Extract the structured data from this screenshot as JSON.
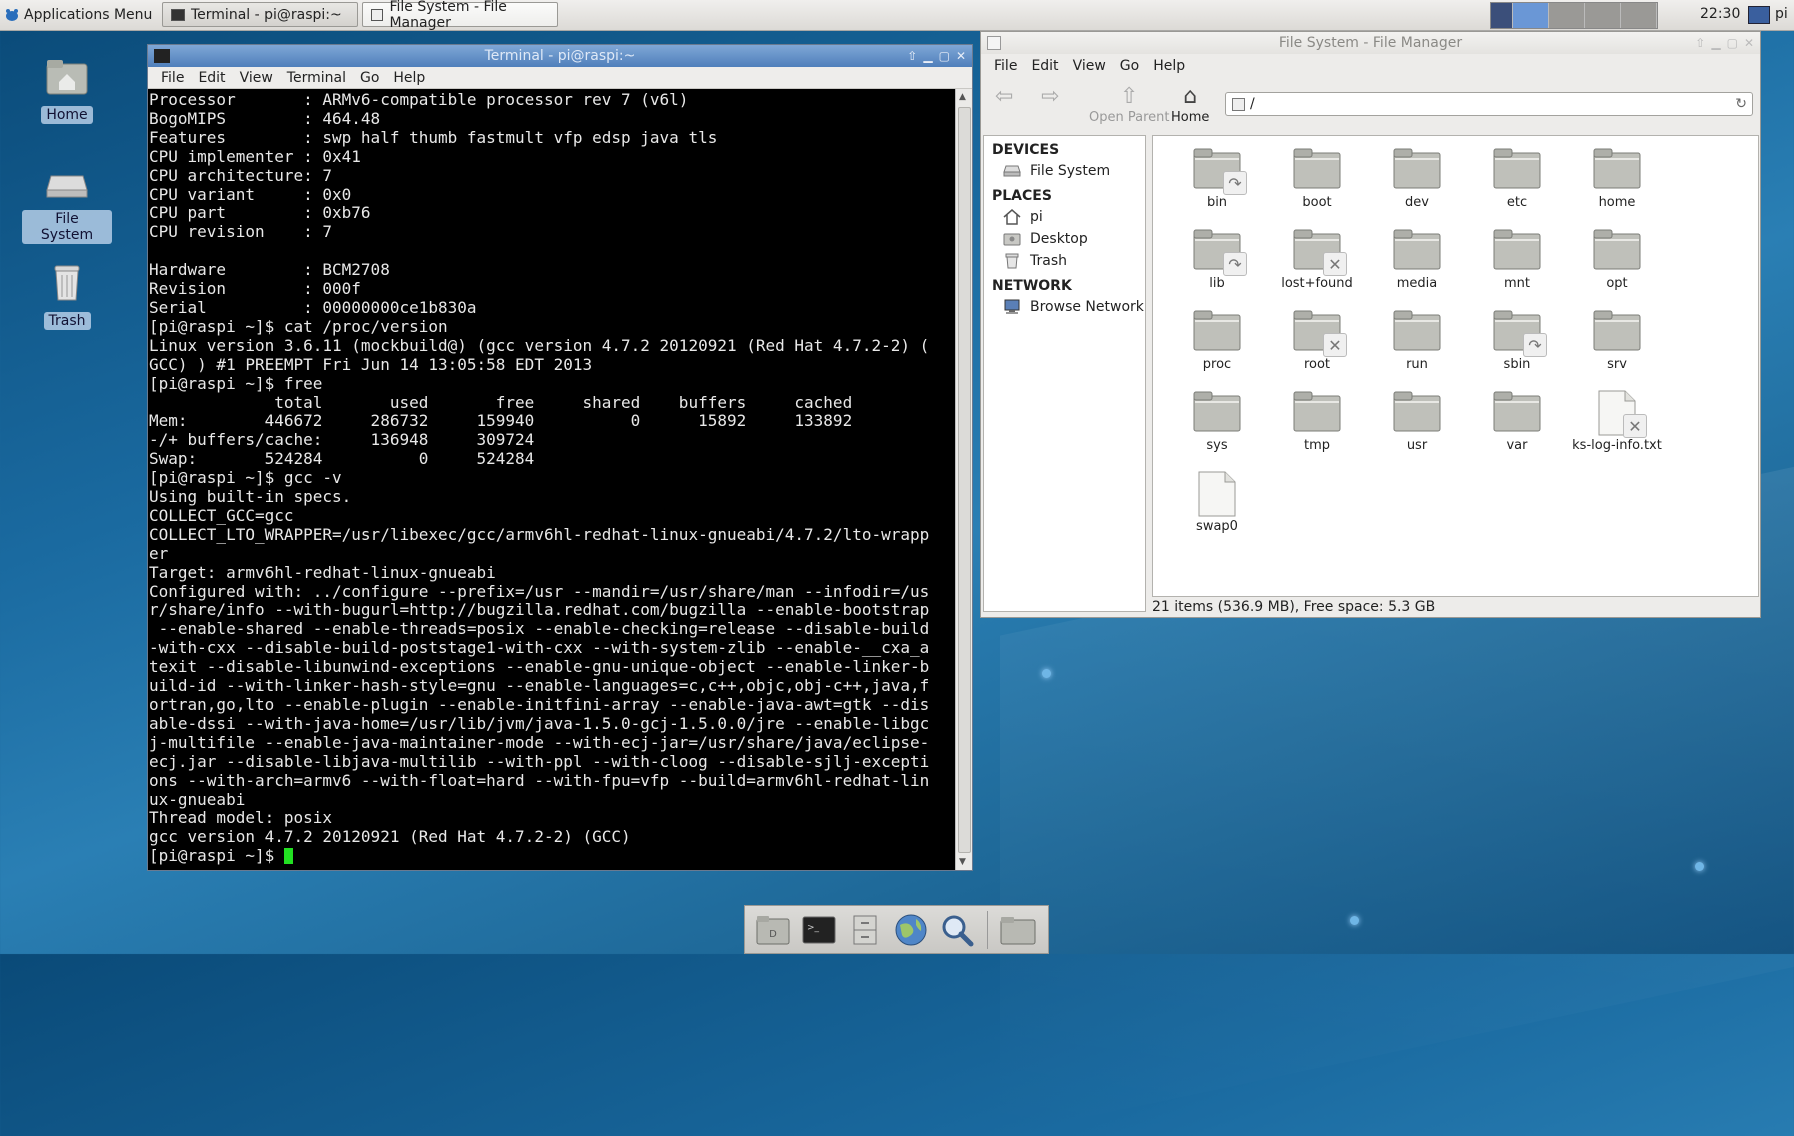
{
  "top_panel": {
    "app_menu_label": "Applications Menu",
    "tasks": [
      {
        "label": "Terminal - pi@raspi:~",
        "icon": "terminal-icon",
        "active": false
      },
      {
        "label": "File System - File Manager",
        "icon": "file-manager-icon",
        "active": true
      }
    ],
    "clock": "22:30",
    "user": "pi"
  },
  "desktop_icons": [
    {
      "label": "Home",
      "icon": "home-folder-icon"
    },
    {
      "label": "File System",
      "icon": "drive-icon"
    },
    {
      "label": "Trash",
      "icon": "trash-icon"
    }
  ],
  "terminal": {
    "title": "Terminal - pi@raspi:~",
    "menu": [
      "File",
      "Edit",
      "View",
      "Terminal",
      "Go",
      "Help"
    ],
    "lines": [
      "Processor       : ARMv6-compatible processor rev 7 (v6l)",
      "BogoMIPS        : 464.48",
      "Features        : swp half thumb fastmult vfp edsp java tls",
      "CPU implementer : 0x41",
      "CPU architecture: 7",
      "CPU variant     : 0x0",
      "CPU part        : 0xb76",
      "CPU revision    : 7",
      "",
      "Hardware        : BCM2708",
      "Revision        : 000f",
      "Serial          : 00000000ce1b830a",
      "[pi@raspi ~]$ cat /proc/version",
      "Linux version 3.6.11 (mockbuild@) (gcc version 4.7.2 20120921 (Red Hat 4.7.2-2) (",
      "GCC) ) #1 PREEMPT Fri Jun 14 13:05:58 EDT 2013",
      "[pi@raspi ~]$ free",
      "             total       used       free     shared    buffers     cached",
      "Mem:        446672     286732     159940          0      15892     133892",
      "-/+ buffers/cache:     136948     309724",
      "Swap:       524284          0     524284",
      "[pi@raspi ~]$ gcc -v",
      "Using built-in specs.",
      "COLLECT_GCC=gcc",
      "COLLECT_LTO_WRAPPER=/usr/libexec/gcc/armv6hl-redhat-linux-gnueabi/4.7.2/lto-wrapp",
      "er",
      "Target: armv6hl-redhat-linux-gnueabi",
      "Configured with: ../configure --prefix=/usr --mandir=/usr/share/man --infodir=/us",
      "r/share/info --with-bugurl=http://bugzilla.redhat.com/bugzilla --enable-bootstrap",
      " --enable-shared --enable-threads=posix --enable-checking=release --disable-build",
      "-with-cxx --disable-build-poststage1-with-cxx --with-system-zlib --enable-__cxa_a",
      "texit --disable-libunwind-exceptions --enable-gnu-unique-object --enable-linker-b",
      "uild-id --with-linker-hash-style=gnu --enable-languages=c,c++,objc,obj-c++,java,f",
      "ortran,go,lto --enable-plugin --enable-initfini-array --enable-java-awt=gtk --dis",
      "able-dssi --with-java-home=/usr/lib/jvm/java-1.5.0-gcj-1.5.0.0/jre --enable-libgc",
      "j-multifile --enable-java-maintainer-mode --with-ecj-jar=/usr/share/java/eclipse-",
      "ecj.jar --disable-libjava-multilib --with-ppl --with-cloog --disable-sjlj-excepti",
      "ons --with-arch=armv6 --with-float=hard --with-fpu=vfp --build=armv6hl-redhat-lin",
      "ux-gnueabi",
      "Thread model: posix",
      "gcc version 4.7.2 20120921 (Red Hat 4.7.2-2) (GCC)"
    ],
    "prompt": "[pi@raspi ~]$ "
  },
  "file_manager": {
    "title": "File System - File Manager",
    "menu": [
      "File",
      "Edit",
      "View",
      "Go",
      "Help"
    ],
    "toolbar": {
      "back_icon": "back-arrow-icon",
      "forward_icon": "forward-arrow-icon",
      "open_parent_label": "Open Parent",
      "home_label": "Home"
    },
    "location": "/",
    "sidebar": {
      "devices_heading": "DEVICES",
      "devices": [
        {
          "label": "File System",
          "icon": "drive-icon"
        }
      ],
      "places_heading": "PLACES",
      "places": [
        {
          "label": "pi",
          "icon": "home-icon"
        },
        {
          "label": "Desktop",
          "icon": "desktop-icon"
        },
        {
          "label": "Trash",
          "icon": "trash-icon"
        }
      ],
      "network_heading": "NETWORK",
      "network": [
        {
          "label": "Browse Network",
          "icon": "network-icon"
        }
      ]
    },
    "items": [
      {
        "name": "bin",
        "type": "folder",
        "badge": "symlink"
      },
      {
        "name": "boot",
        "type": "folder",
        "badge": ""
      },
      {
        "name": "dev",
        "type": "folder",
        "badge": ""
      },
      {
        "name": "etc",
        "type": "folder",
        "badge": ""
      },
      {
        "name": "home",
        "type": "folder",
        "badge": ""
      },
      {
        "name": "lib",
        "type": "folder",
        "badge": "symlink"
      },
      {
        "name": "lost+found",
        "type": "folder",
        "badge": "locked"
      },
      {
        "name": "media",
        "type": "folder",
        "badge": ""
      },
      {
        "name": "mnt",
        "type": "folder",
        "badge": ""
      },
      {
        "name": "opt",
        "type": "folder",
        "badge": ""
      },
      {
        "name": "proc",
        "type": "folder",
        "badge": ""
      },
      {
        "name": "root",
        "type": "folder",
        "badge": "locked"
      },
      {
        "name": "run",
        "type": "folder",
        "badge": ""
      },
      {
        "name": "sbin",
        "type": "folder",
        "badge": "symlink"
      },
      {
        "name": "srv",
        "type": "folder",
        "badge": ""
      },
      {
        "name": "sys",
        "type": "folder",
        "badge": ""
      },
      {
        "name": "tmp",
        "type": "folder",
        "badge": ""
      },
      {
        "name": "usr",
        "type": "folder",
        "badge": ""
      },
      {
        "name": "var",
        "type": "folder",
        "badge": ""
      },
      {
        "name": "ks-log-info.txt",
        "type": "file",
        "badge": "locked"
      },
      {
        "name": "swap0",
        "type": "file",
        "badge": ""
      }
    ],
    "status": "21 items (536.9 MB), Free space: 5.3 GB"
  },
  "dock": {
    "items": [
      "file-manager-icon",
      "terminal-icon",
      "file-cabinet-icon",
      "web-browser-icon",
      "search-icon",
      "folder-icon"
    ]
  },
  "colors": {
    "terminal_cursor": "#22e022",
    "title_active": "#5f8cc6"
  }
}
